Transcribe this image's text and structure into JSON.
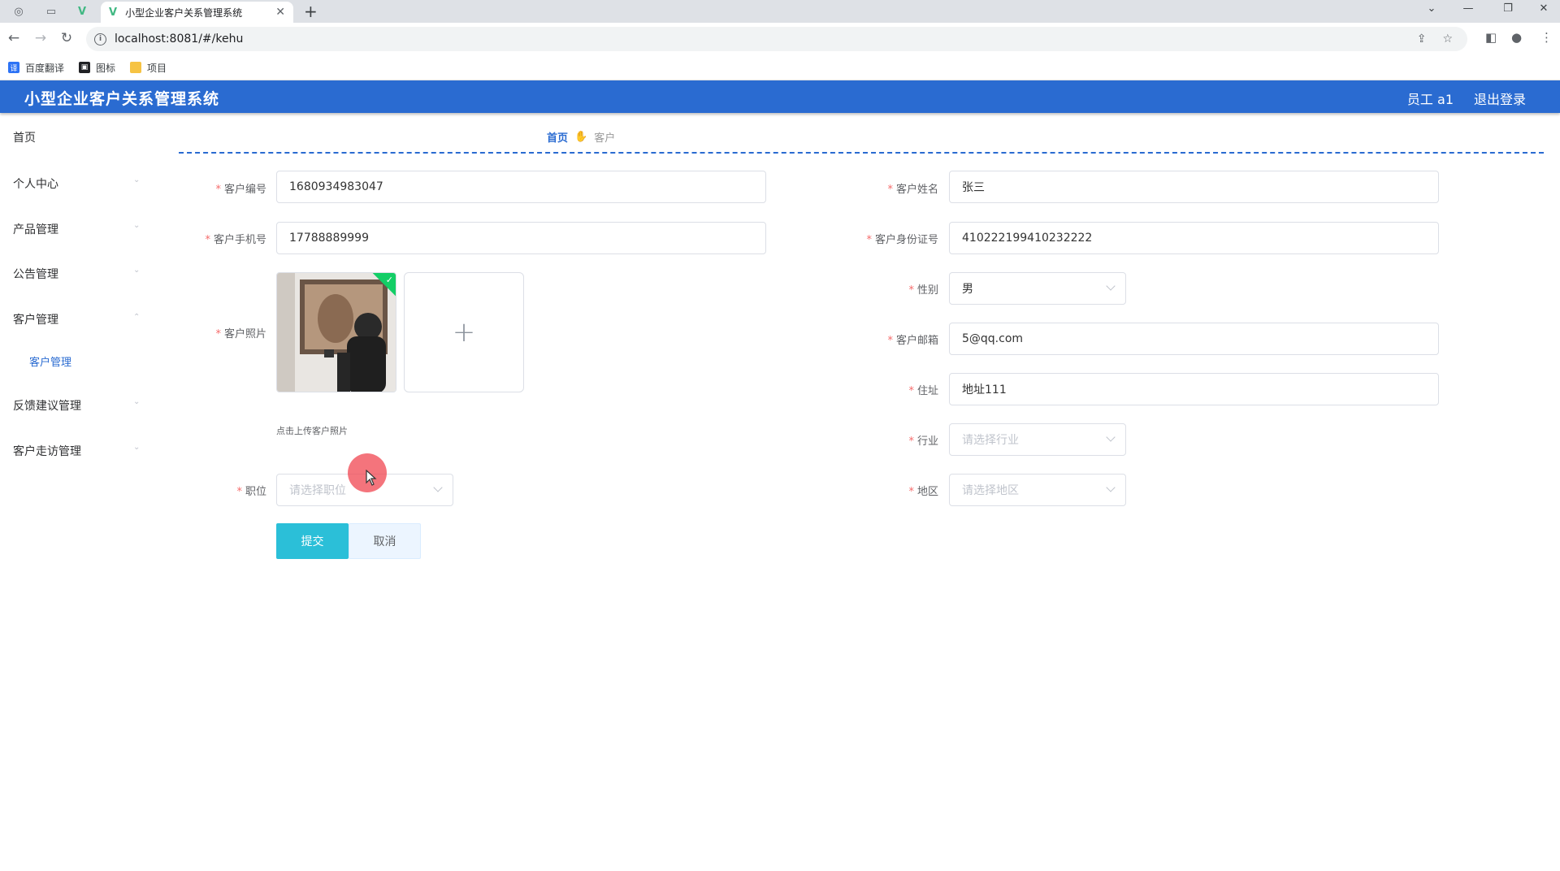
{
  "browser": {
    "tab_title": "小型企业客户关系管理系统",
    "url": "localhost:8081/#/kehu",
    "bookmarks": [
      {
        "label": "百度翻译",
        "icon_text": "译",
        "color": "#2d73f5"
      },
      {
        "label": "图标",
        "icon_text": "",
        "color": "#202124"
      },
      {
        "label": "项目",
        "icon_text": "",
        "color": "#f6c343"
      }
    ]
  },
  "header": {
    "title": "小型企业客户关系管理系统",
    "user": "员工 a1",
    "logout": "退出登录"
  },
  "sidebar": {
    "items": [
      {
        "label": "首页"
      },
      {
        "label": "个人中心"
      },
      {
        "label": "产品管理"
      },
      {
        "label": "公告管理"
      },
      {
        "label": "客户管理"
      },
      {
        "label": "反馈建议管理"
      },
      {
        "label": "客户走访管理"
      }
    ],
    "subitem": "客户管理"
  },
  "breadcrumb": {
    "home": "首页",
    "current": "客户"
  },
  "form": {
    "customer_no": {
      "label": "客户编号",
      "value": "1680934983047"
    },
    "customer_name": {
      "label": "客户姓名",
      "value": "张三"
    },
    "phone": {
      "label": "客户手机号",
      "value": "17788889999"
    },
    "id_card": {
      "label": "客户身份证号",
      "value": "410222199410232222"
    },
    "photo": {
      "label": "客户照片",
      "tip": "点击上传客户照片"
    },
    "gender": {
      "label": "性别",
      "value": "男"
    },
    "email": {
      "label": "客户邮箱",
      "value": "5@qq.com"
    },
    "address": {
      "label": "住址",
      "value": "地址111"
    },
    "industry": {
      "label": "行业",
      "placeholder": "请选择行业"
    },
    "position": {
      "label": "职位",
      "placeholder": "请选择职位"
    },
    "region": {
      "label": "地区",
      "placeholder": "请选择地区"
    },
    "submit": "提交",
    "cancel": "取消"
  },
  "colors": {
    "brand": "#2a6bd1",
    "submit": "#2bbfd8",
    "required": "#f56c6c",
    "success": "#13ce66"
  }
}
